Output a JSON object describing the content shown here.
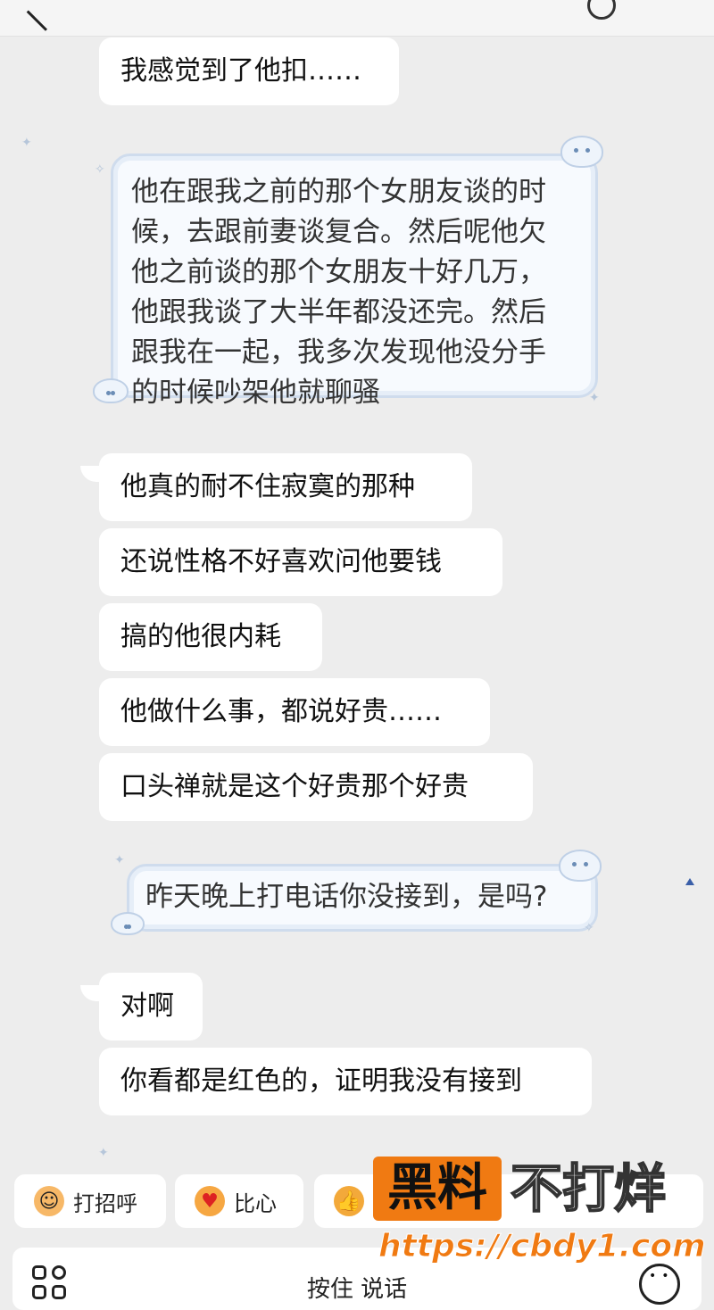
{
  "messages": [
    {
      "text": "我感觉到了他扣……"
    },
    {
      "text": "他在跟我之前的那个女朋友谈的时\n候，去跟前妻谈复合。然后呢他欠\n他之前谈的那个女朋友十好几万，\n他跟我谈了大半年都没还完。然后\n跟我在一起，我多次发现他没分手\n的时候吵架他就聊骚"
    },
    {
      "text": "他真的耐不住寂寞的那种"
    },
    {
      "text": "还说性格不好喜欢问他要钱"
    },
    {
      "text": "搞的他很内耗"
    },
    {
      "text": "他做什么事，都说好贵……"
    },
    {
      "text": "口头禅就是这个好贵那个好贵"
    },
    {
      "text": "昨天晚上打电话你没接到，是吗?"
    },
    {
      "text": "对啊"
    },
    {
      "text": "你看都是红色的，证明我没有接到"
    }
  ],
  "quick_replies": [
    {
      "label": "打招呼",
      "icon": "smile-wave-icon"
    },
    {
      "label": "比心",
      "icon": "heart-hand-icon"
    },
    {
      "label": "",
      "icon": "thumbs-up-icon"
    }
  ],
  "input": {
    "hold_to_talk": "按住 说话"
  },
  "watermark": {
    "box": "黑料",
    "text": "不打烊",
    "url": "https://cbdy1.com"
  },
  "colors": {
    "background": "#ededed",
    "bubble": "#ffffff",
    "watermark_orange": "#f07a12"
  }
}
